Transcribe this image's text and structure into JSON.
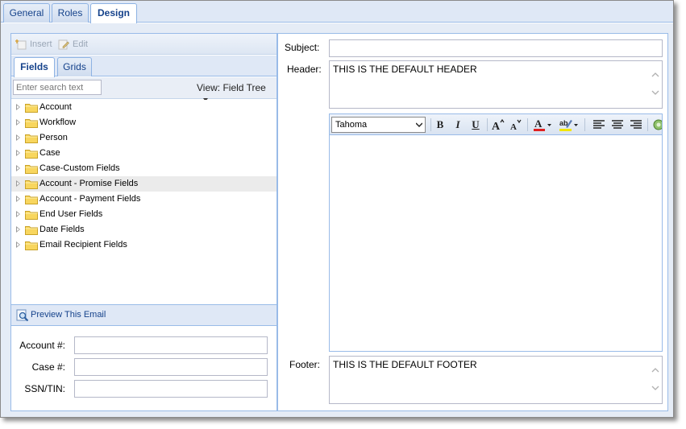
{
  "top_tabs": [
    {
      "label": "General"
    },
    {
      "label": "Roles"
    },
    {
      "label": "Design",
      "active": true
    }
  ],
  "left": {
    "toolbar": {
      "insert_label": "Insert",
      "edit_label": "Edit"
    },
    "tabs": [
      {
        "label": "Fields",
        "active": true
      },
      {
        "label": "Grids"
      }
    ],
    "search": {
      "placeholder": "Enter search text"
    },
    "view": {
      "label": "View: Field Tree"
    },
    "tree": [
      {
        "label": "Account"
      },
      {
        "label": "Workflow"
      },
      {
        "label": "Person"
      },
      {
        "label": "Case"
      },
      {
        "label": "Case-Custom Fields"
      },
      {
        "label": "Account - Promise Fields",
        "selected": true
      },
      {
        "label": "Account - Payment Fields"
      },
      {
        "label": "End User Fields"
      },
      {
        "label": "Date Fields"
      },
      {
        "label": "Email Recipient Fields"
      }
    ],
    "preview": {
      "label": "Preview This Email"
    },
    "form": {
      "account_label": "Account #:",
      "case_label": "Case #:",
      "ssn_label": "SSN/TIN:"
    }
  },
  "right": {
    "subject_label": "Subject:",
    "subject_value": "",
    "header_label": "Header:",
    "header_value": "THIS IS THE DEFAULT HEADER",
    "footer_label": "Footer:",
    "footer_value": "THIS IS THE DEFAULT FOOTER",
    "editor": {
      "font": "Tahoma",
      "bold": "B",
      "italic": "I",
      "underline": "U"
    }
  },
  "colors": {
    "accent": "#15428b",
    "border": "#99bbe8",
    "panel_bg": "#dfe8f6",
    "font_color_swatch": "#e02020",
    "highlight_swatch": "#f2e600"
  }
}
